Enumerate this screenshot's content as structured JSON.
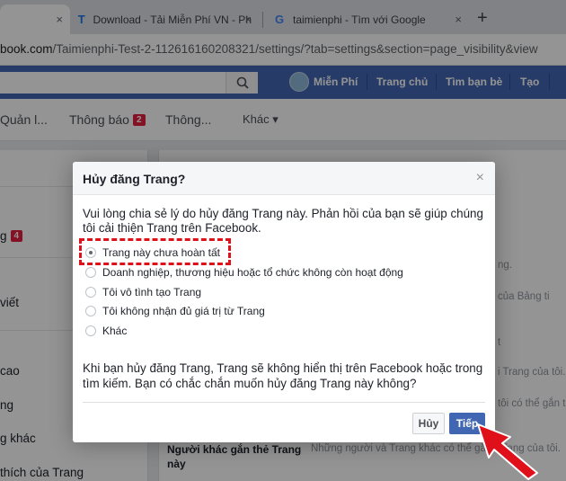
{
  "browser": {
    "tabs": [
      {
        "title": "",
        "active": true
      },
      {
        "title": "Download - Tải Miễn Phí VN - Ph",
        "favicon": "T"
      },
      {
        "title": "taimienphi - Tìm với Google",
        "favicon": "G"
      }
    ],
    "close_glyph": "×",
    "newtab_glyph": "+",
    "url_host": "book.com",
    "url_path": "/Taimienphi-Test-2-112616160208321/settings/?tab=settings&section=page_visibility&view"
  },
  "fb": {
    "nav": {
      "profile": "Miễn Phí",
      "home": "Trang chủ",
      "friends": "Tìm bạn bè",
      "create": "Tạo"
    }
  },
  "page_nav": {
    "manage": "Quản l...",
    "notifications": "Thông báo",
    "notifications_count": "2",
    "insights": "Thông...",
    "more": "Khác ▾"
  },
  "sidebar": {
    "items": [
      {
        "label": "g",
        "badge": "4"
      },
      {
        "label": "viết"
      },
      {
        "label": "cao"
      },
      {
        "label": "ng"
      },
      {
        "label": "g khác"
      },
      {
        "label": "thích của Trang"
      }
    ]
  },
  "content": {
    "row_label": "Người khác gắn thẻ Trang này",
    "row_desc": "Những người và Trang khác có thể gắn thẻ",
    "side_snippets": [
      "ng.",
      "của Bảng ti",
      "t",
      "i Trang của tôi.",
      "tôi có thể gắn th",
      "Trang của tôi."
    ]
  },
  "dialog": {
    "title": "Hủy đăng Trang?",
    "close": "×",
    "intro": "Vui lòng chia sẻ lý do hủy đăng Trang này. Phản hồi của bạn sẽ giúp chúng tôi cải thiện Trang trên Facebook.",
    "options": [
      {
        "label": "Trang này chưa hoàn tất",
        "checked": true
      },
      {
        "label": "Doanh nghiệp, thương hiệu hoặc tổ chức không còn hoạt động",
        "checked": false
      },
      {
        "label": "Tôi vô tình tạo Trang",
        "checked": false
      },
      {
        "label": "Tôi không nhận đủ giá trị từ Trang",
        "checked": false
      },
      {
        "label": "Khác",
        "checked": false
      }
    ],
    "warning": "Khi bạn hủy đăng Trang, Trang sẽ không hiển thị trên Facebook hoặc trong tìm kiếm. Bạn có chắc chắn muốn hủy đăng Trang này không?",
    "cancel_label": "Hủy",
    "next_label": "Tiếp"
  },
  "colors": {
    "fb_blue": "#4267b2",
    "highlight_red": "#e0101b"
  }
}
